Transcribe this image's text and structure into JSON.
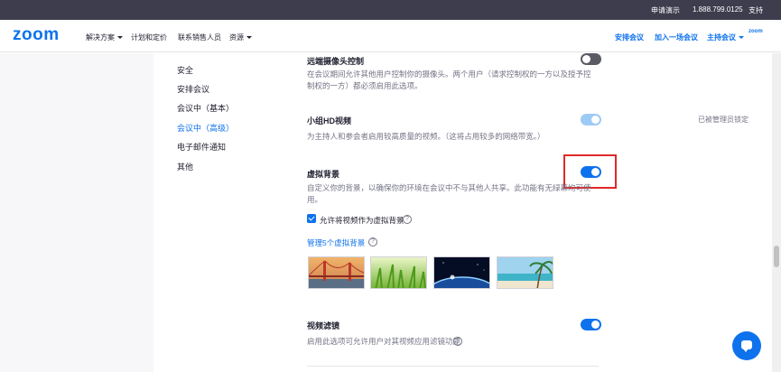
{
  "topbar": {
    "request_demo": "申请演示",
    "phone": "1.888.799.0125",
    "support": "支持"
  },
  "nav": {
    "logo": "zoom",
    "solutions": "解决方案",
    "plans": "计划和定价",
    "contact_sales": "联系销售人员",
    "resources": "资源",
    "schedule": "安排会议",
    "join": "加入一场会议",
    "host": "主持会议",
    "brand_mini": "zoom"
  },
  "sidebar": {
    "items": [
      {
        "label": "安全",
        "active": false
      },
      {
        "label": "安排会议",
        "active": false
      },
      {
        "label": "会议中（基本）",
        "active": false
      },
      {
        "label": "会议中（高级）",
        "active": true
      },
      {
        "label": "电子邮件通知",
        "active": false
      },
      {
        "label": "其他",
        "active": false
      }
    ]
  },
  "settings": {
    "camera_control": {
      "title": "远端摄像头控制",
      "desc_line1": "在会议期间允许其他用户控制你的摄像头。两个用户（请求控制权的一方以及授予控",
      "desc_line2": "制权的一方）都必须启用此选项。",
      "enabled": false
    },
    "hd_video": {
      "title": "小组HD视频",
      "desc": "为主持人和参会者启用较高质量的视频。（这将占用较多的网络带宽。）",
      "enabled": true,
      "locked": true,
      "lock_note": "已被管理员锁定"
    },
    "virtual_bg": {
      "title": "虚拟背景",
      "desc_line1": "自定义你的背景，以确保你的环境在会议中不与其他人共享。此功能有无绿幕均可使",
      "desc_line2": "用。",
      "enabled": true,
      "allow_video_label": "允许将视频作为虚拟背景",
      "allow_video_checked": true,
      "manage_label": "管理5个虚拟背景",
      "backgrounds": [
        "golden-gate-bridge",
        "green-grass",
        "earth-from-space",
        "beach-palm"
      ]
    },
    "video_filters": {
      "title": "视频滤镜",
      "desc": "启用此选项可允许用户对其视频应用滤镜功能",
      "enabled": true
    }
  },
  "colors": {
    "accent": "#0e72ed",
    "highlight": "#e02828",
    "topbar": "#3d3d4e"
  }
}
